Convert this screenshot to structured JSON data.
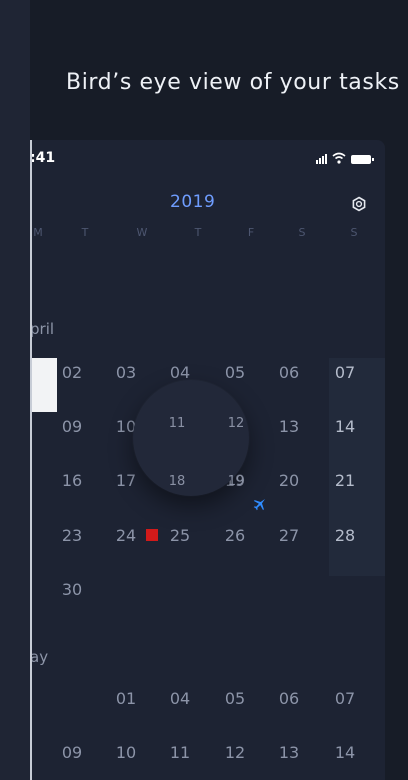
{
  "headline": "Bird’s eye view of your tasks",
  "status": {
    "time": ":41"
  },
  "calendar": {
    "year": "2019",
    "weekdays": [
      "M",
      "T",
      "W",
      "T",
      "F",
      "S",
      "S"
    ],
    "april": {
      "label": "pril",
      "week1": [
        "02",
        "03",
        "04",
        "05",
        "06",
        "07"
      ],
      "week2": [
        "09",
        "10",
        "11",
        "12",
        "13",
        "14"
      ],
      "week3": [
        "16",
        "17",
        "18",
        "19",
        "20",
        "21"
      ],
      "week4": [
        "23",
        "24",
        "25",
        "26",
        "27",
        "28"
      ],
      "week5": [
        "30"
      ]
    },
    "may": {
      "label": "ay",
      "week1": [
        "01",
        "04",
        "05",
        "06",
        "07"
      ],
      "week2": [
        "09",
        "10",
        "11",
        "12",
        "13",
        "14"
      ]
    },
    "magnifier_days": [
      "11",
      "12",
      "18",
      "19"
    ]
  },
  "icons": {
    "settings": "settings-icon",
    "event_marker": "red-square-event",
    "plane": "airplane-icon",
    "signal": "cellular-signal-icon",
    "wifi": "wifi-icon",
    "battery": "battery-icon"
  },
  "colors": {
    "background": "#171c27",
    "panel": "#1d2333",
    "accent_blue": "#6f9dff",
    "event_red": "#d11a1a"
  }
}
